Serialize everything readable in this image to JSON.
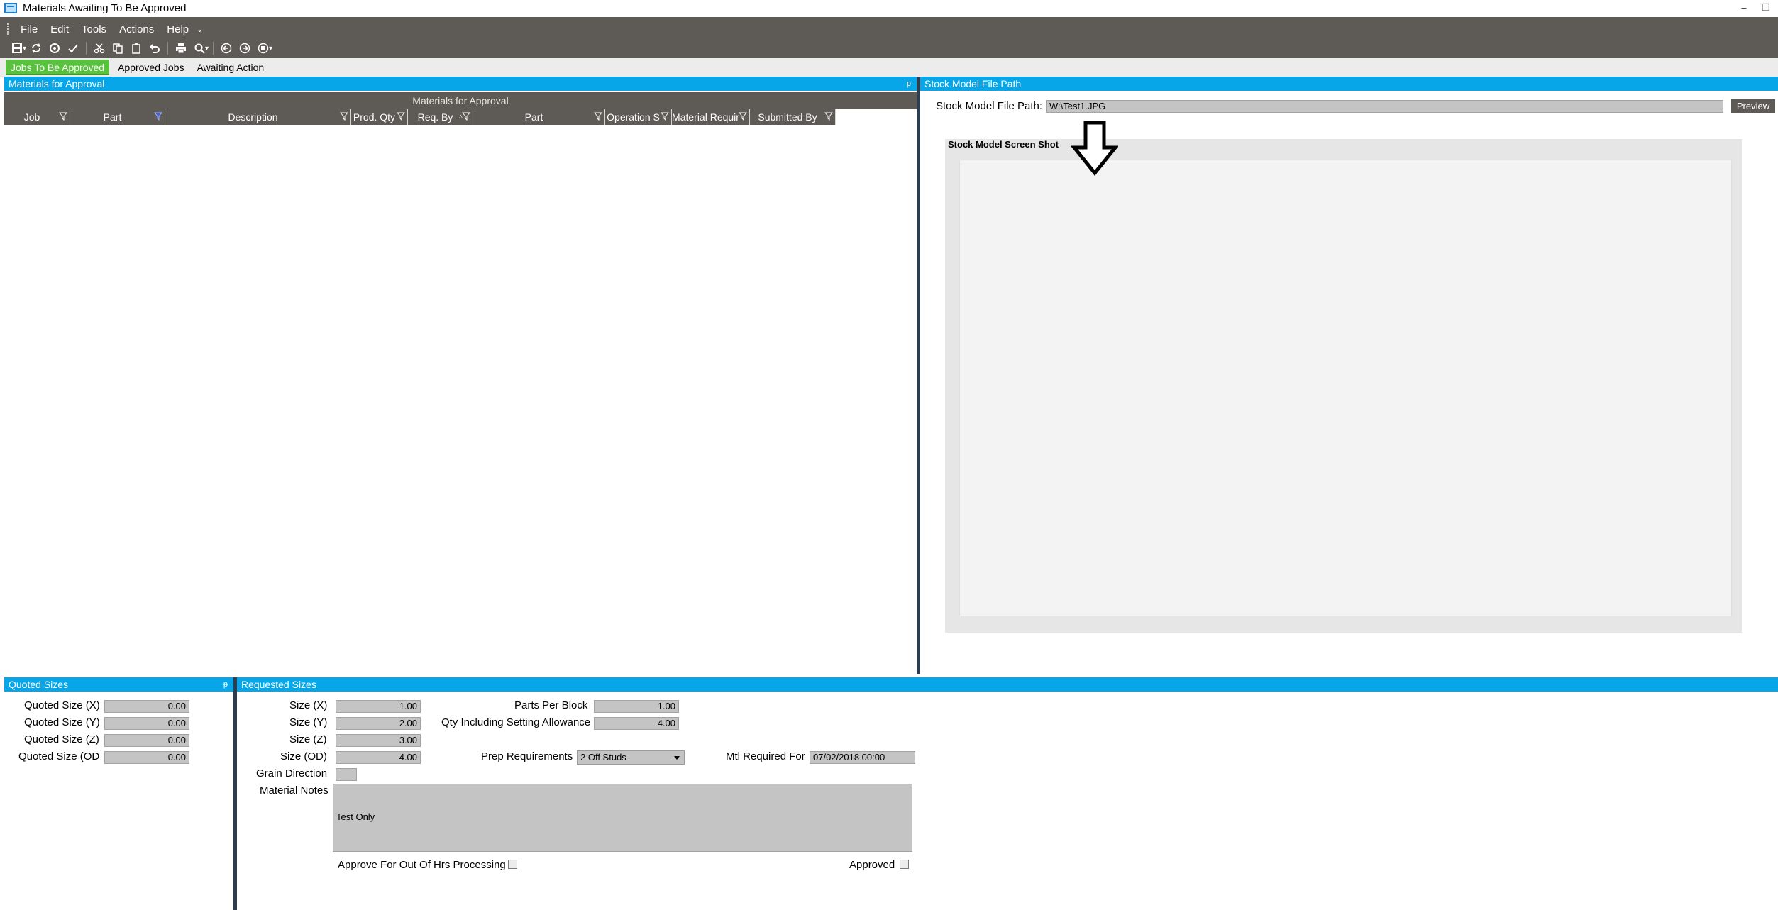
{
  "window": {
    "title": "Materials Awaiting To Be Approved",
    "minimize": "–",
    "restore": "❐"
  },
  "menu": [
    "File",
    "Edit",
    "Tools",
    "Actions",
    "Help"
  ],
  "menu_overflow": "⌄",
  "toolbar": {
    "icons": [
      "save-icon",
      "refresh-icon",
      "clear-icon",
      "check-icon",
      "cut-icon",
      "copy-icon",
      "paste-icon",
      "undo-icon",
      "print-icon",
      "print-preview-icon",
      "back-icon",
      "forward-icon",
      "stop-icon"
    ]
  },
  "tabs": [
    "Jobs To Be Approved",
    "Approved Jobs",
    "Awaiting Action"
  ],
  "left_panel": {
    "header": "Materials for Approval",
    "grid_caption": "Materials for Approval",
    "columns": [
      "Job",
      "Part",
      "Description",
      "Prod. Qty",
      "Req. By",
      "Part",
      "Operation S",
      "Material Requir",
      "Submitted By"
    ],
    "rows": []
  },
  "right_panel": {
    "header": "Stock Model File Path",
    "path_label": "Stock Model File Path:",
    "path_value": "W:\\Test1.JPG",
    "preview_label": "Preview",
    "shot_title": "Stock Model Screen Shot"
  },
  "quoted": {
    "header": "Quoted Sizes",
    "rows": [
      {
        "label": "Quoted Size (X)",
        "value": "0.00"
      },
      {
        "label": "Quoted Size (Y)",
        "value": "0.00"
      },
      {
        "label": "Quoted Size (Z)",
        "value": "0.00"
      },
      {
        "label": "Quoted Size (OD",
        "value": "0.00"
      }
    ]
  },
  "requested": {
    "header": "Requested Sizes",
    "size_x_label": "Size (X)",
    "size_x": "1.00",
    "size_y_label": "Size (Y)",
    "size_y": "2.00",
    "size_z_label": "Size (Z)",
    "size_z": "3.00",
    "size_od_label": "Size (OD)",
    "size_od": "4.00",
    "grain_label": "Grain Direction",
    "notes_label": "Material Notes",
    "notes_value": "Test Only",
    "ppb_label": "Parts Per Block",
    "ppb": "1.00",
    "qty_label": "Qty Including Setting Allowance",
    "qty": "4.00",
    "prep_label": "Prep Requirements",
    "prep": "2 Off Studs",
    "mtl_label": "Mtl Required For",
    "mtl": "07/02/2018 00:00",
    "out_of_hrs_label": "Approve For Out Of Hrs Processing",
    "approved_label": "Approved"
  }
}
